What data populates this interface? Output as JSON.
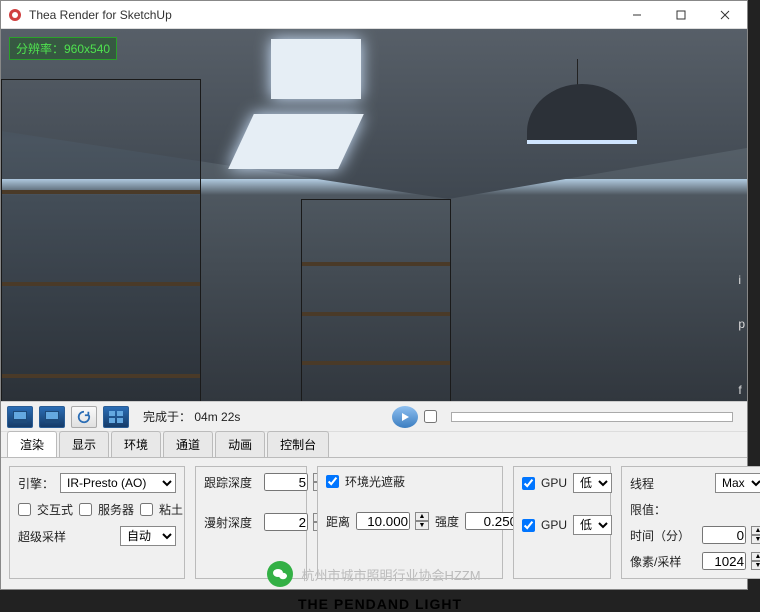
{
  "window": {
    "title": "Thea Render for SketchUp"
  },
  "viewport": {
    "resolution_label": "分辨率：960x540"
  },
  "toolbar": {
    "completed_prefix": "完成于：",
    "completed_time": "04m 22s"
  },
  "tabs": [
    "渲染",
    "显示",
    "环境",
    "通道",
    "动画",
    "控制台"
  ],
  "engine": {
    "label": "引擎：",
    "selected": "IR-Presto (AO)",
    "interactive": "交互式",
    "server": "服务器",
    "clay": "粘土",
    "supersample_label": "超级采样",
    "supersample_value": "自动"
  },
  "trace": {
    "depth_label": "跟踪深度",
    "depth_value": "5",
    "diffuse_label": "漫射深度",
    "diffuse_value": "2"
  },
  "ao": {
    "enable_label": "环境光遮蔽",
    "distance_label": "距离",
    "distance_value": "10.000",
    "intensity_label": "强度",
    "intensity_value": "0.250"
  },
  "gpu": {
    "gpu1_label": "GPU",
    "gpu1_value": "低",
    "gpu2_label": "GPU",
    "gpu2_value": "低"
  },
  "limits": {
    "threads_label": "线程",
    "threads_value": "Max",
    "limit_label": "限值：",
    "time_label": "时间（分）",
    "time_value": "0",
    "samples_label": "像素/采样",
    "samples_value": "1024"
  },
  "watermark": "杭州市城市照明行业协会HZZM",
  "trail": {
    "a": "i",
    "b": "p",
    "c": "f"
  },
  "cutoff": "THE PENDAND LIGHT"
}
